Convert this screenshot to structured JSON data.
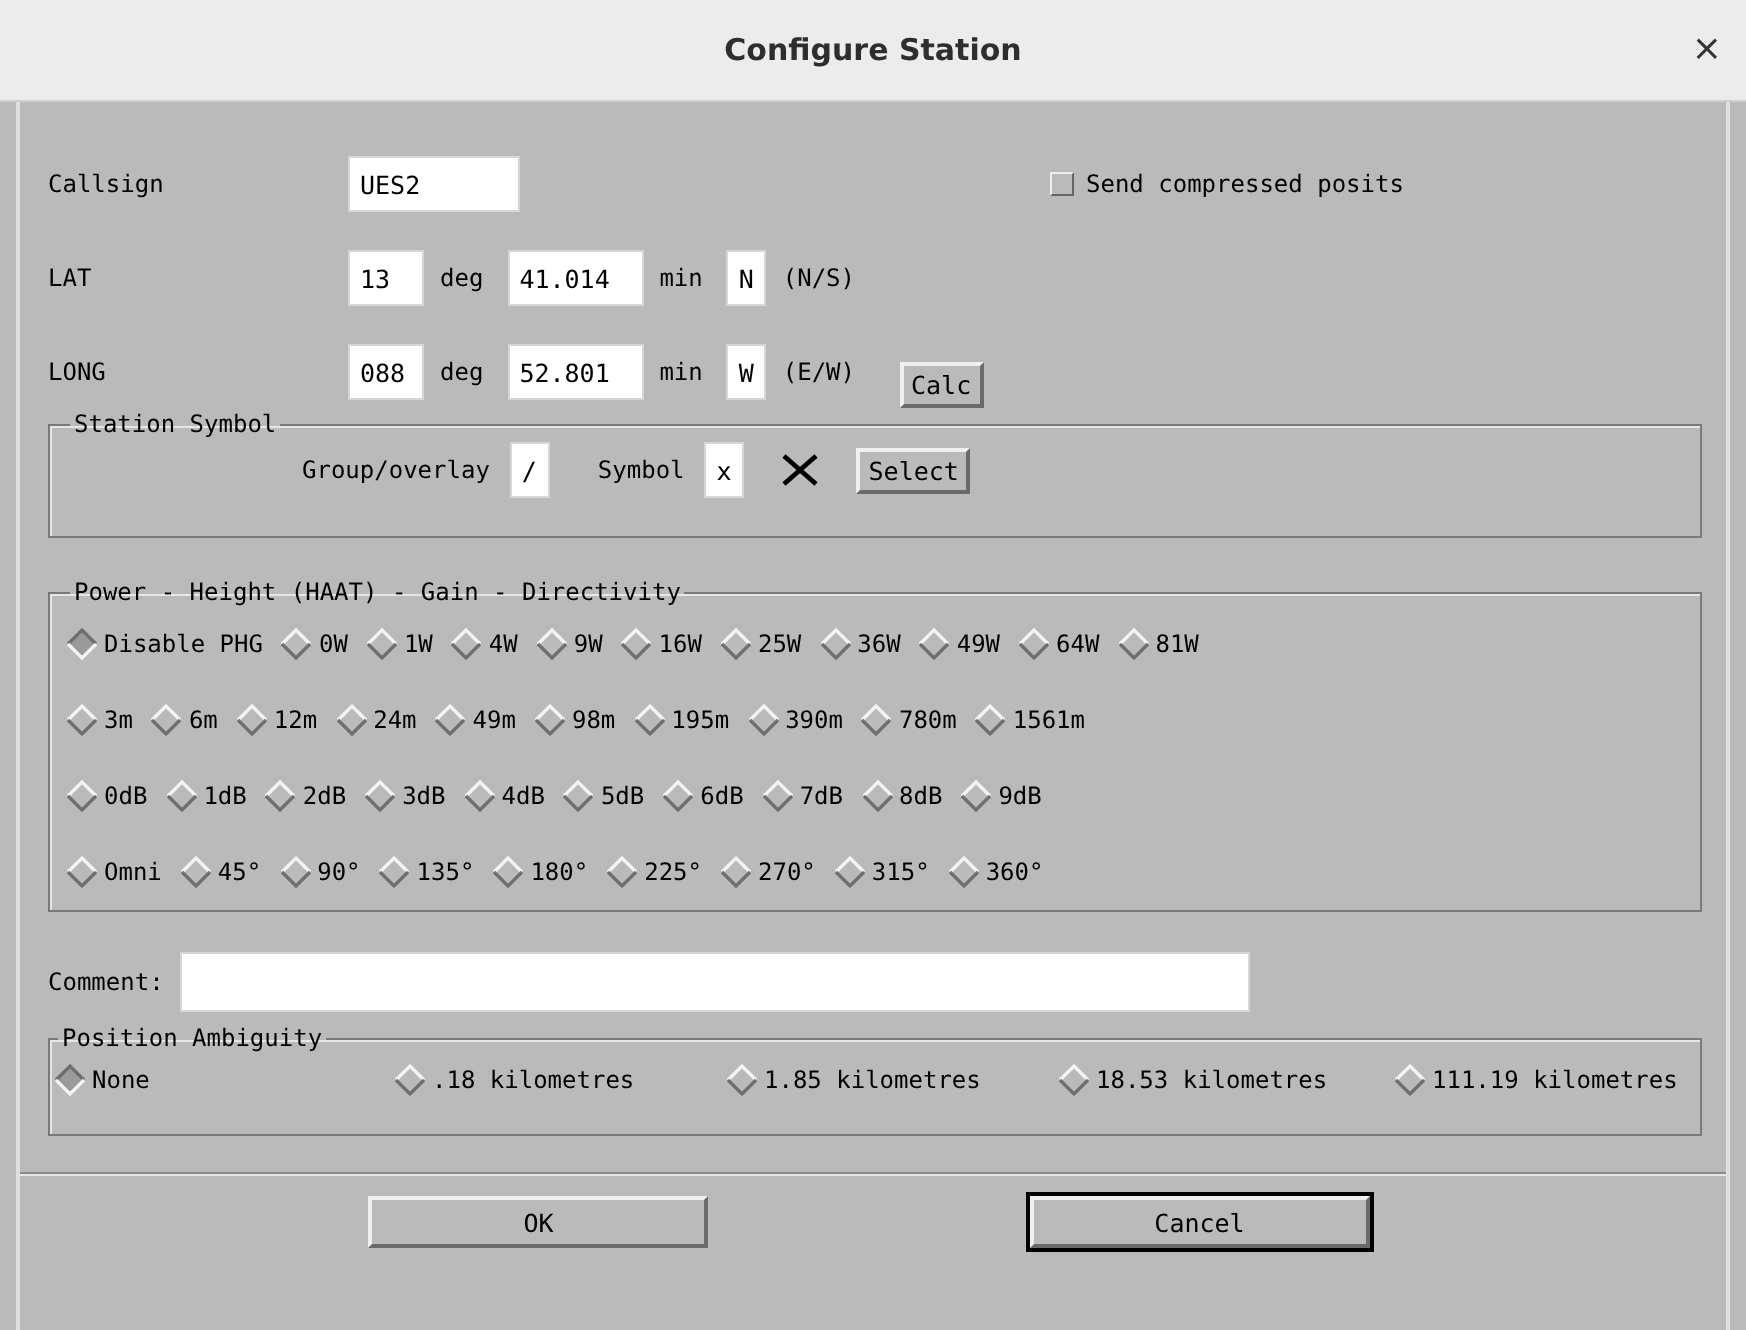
{
  "window": {
    "title": "Configure Station",
    "close": "×"
  },
  "callsign": {
    "label": "Callsign",
    "value": "UES2"
  },
  "compressed": {
    "label": "Send compressed posits",
    "checked": false
  },
  "coords": [
    {
      "label": "LAT",
      "deg": "13",
      "deg_unit": "deg",
      "min": "41.014",
      "min_unit": "min",
      "hemi": "N",
      "hint": "(N/S)"
    },
    {
      "label": "LONG",
      "deg": "088",
      "deg_unit": "deg",
      "min": "52.801",
      "min_unit": "min",
      "hemi": "W",
      "hint": "(E/W)"
    }
  ],
  "calc_button": "Calc",
  "station_symbol": {
    "title": "Station Symbol",
    "group_label": "Group/overlay",
    "group_value": "/",
    "symbol_label": "Symbol",
    "symbol_value": "x",
    "select_button": "Select"
  },
  "phg": {
    "title": "Power - Height (HAAT) - Gain - Directivity",
    "power": [
      {
        "label": "Disable PHG",
        "selected": true
      },
      {
        "label": "0W",
        "selected": false
      },
      {
        "label": "1W",
        "selected": false
      },
      {
        "label": "4W",
        "selected": false
      },
      {
        "label": "9W",
        "selected": false
      },
      {
        "label": "16W",
        "selected": false
      },
      {
        "label": "25W",
        "selected": false
      },
      {
        "label": "36W",
        "selected": false
      },
      {
        "label": "49W",
        "selected": false
      },
      {
        "label": "64W",
        "selected": false
      },
      {
        "label": "81W",
        "selected": false
      }
    ],
    "height": [
      {
        "label": "3m",
        "selected": false
      },
      {
        "label": "6m",
        "selected": false
      },
      {
        "label": "12m",
        "selected": false
      },
      {
        "label": "24m",
        "selected": false
      },
      {
        "label": "49m",
        "selected": false
      },
      {
        "label": "98m",
        "selected": false
      },
      {
        "label": "195m",
        "selected": false
      },
      {
        "label": "390m",
        "selected": false
      },
      {
        "label": "780m",
        "selected": false
      },
      {
        "label": "1561m",
        "selected": false
      }
    ],
    "gain": [
      {
        "label": "0dB",
        "selected": false
      },
      {
        "label": "1dB",
        "selected": false
      },
      {
        "label": "2dB",
        "selected": false
      },
      {
        "label": "3dB",
        "selected": false
      },
      {
        "label": "4dB",
        "selected": false
      },
      {
        "label": "5dB",
        "selected": false
      },
      {
        "label": "6dB",
        "selected": false
      },
      {
        "label": "7dB",
        "selected": false
      },
      {
        "label": "8dB",
        "selected": false
      },
      {
        "label": "9dB",
        "selected": false
      }
    ],
    "directivity": [
      {
        "label": "Omni",
        "selected": false
      },
      {
        "label": "45°",
        "selected": false
      },
      {
        "label": "90°",
        "selected": false
      },
      {
        "label": "135°",
        "selected": false
      },
      {
        "label": "180°",
        "selected": false
      },
      {
        "label": "225°",
        "selected": false
      },
      {
        "label": "270°",
        "selected": false
      },
      {
        "label": "315°",
        "selected": false
      },
      {
        "label": "360°",
        "selected": false
      }
    ]
  },
  "comment": {
    "label": "Comment:"
  },
  "ambiguity": {
    "title": "Position Ambiguity",
    "options": [
      {
        "label": "None",
        "selected": true
      },
      {
        "label": ".18 kilometres",
        "selected": false
      },
      {
        "label": "1.85 kilometres",
        "selected": false
      },
      {
        "label": "18.53 kilometres",
        "selected": false
      },
      {
        "label": "111.19 kilometres",
        "selected": false
      }
    ]
  },
  "buttons": [
    {
      "label": "OK",
      "focused": false
    },
    {
      "label": "Cancel",
      "focused": true
    }
  ]
}
